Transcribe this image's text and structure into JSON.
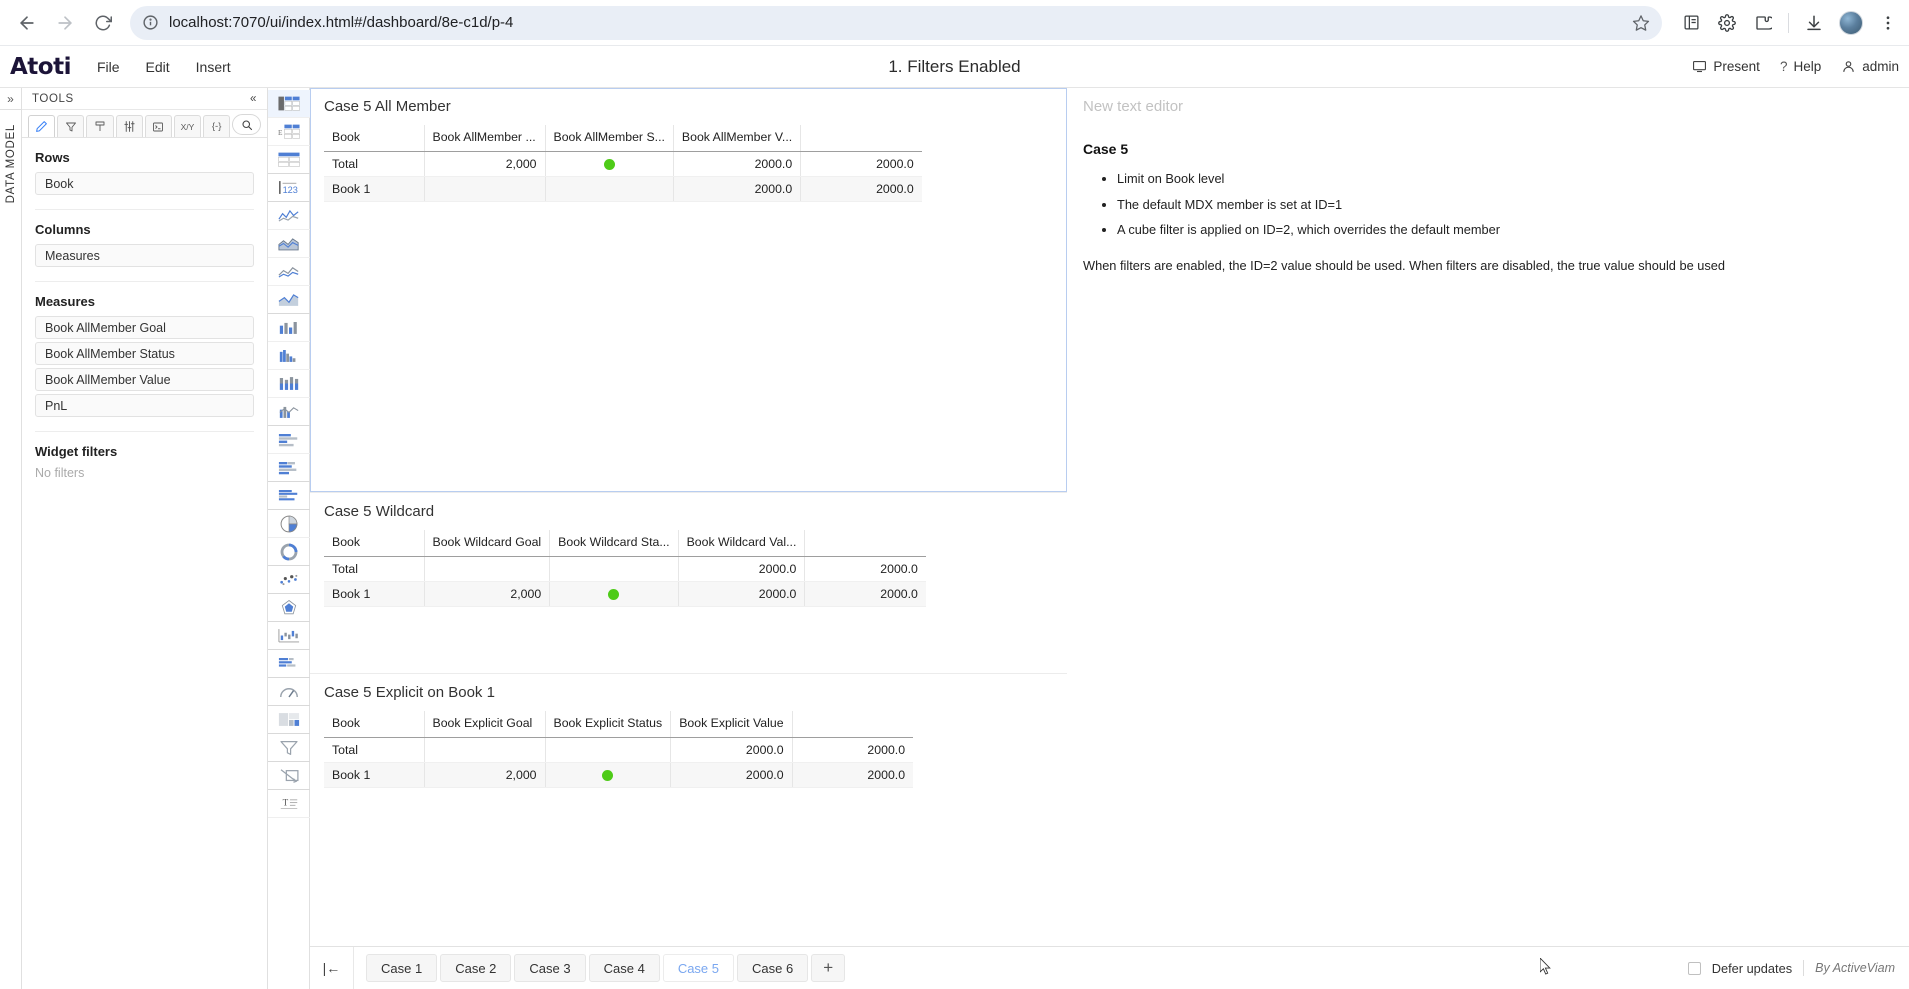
{
  "browser": {
    "url": "localhost:7070/ui/index.html#/dashboard/8e-c1d/p-4",
    "back_label": "←",
    "forward_label": "→",
    "reload_label": "⟳",
    "site_info_label": "ⓘ",
    "bookmark_label": "☆",
    "extension_labels": [
      "reading-list-icon",
      "gear-icon",
      "extensions-icon",
      "download-icon",
      "profile-avatar",
      "kebab-menu-icon"
    ]
  },
  "app": {
    "brand": "Atoti",
    "menu": [
      "File",
      "Edit",
      "Insert"
    ],
    "title": "1. Filters Enabled",
    "right": {
      "present": "Present",
      "help": "Help",
      "help_mark": "?",
      "user": "admin"
    }
  },
  "rail": {
    "expand": "»",
    "label": "DATA MODEL"
  },
  "tools": {
    "header": "TOOLS",
    "collapse": "«",
    "tabs": [
      {
        "name": "pencil-icon",
        "glyph": "✎",
        "active": true
      },
      {
        "name": "funnel-icon",
        "glyph": "∇",
        "active": false
      },
      {
        "name": "paintbrush-icon",
        "glyph": "✐",
        "active": false
      },
      {
        "name": "sliders-icon",
        "glyph": "⩝",
        "active": false
      },
      {
        "name": "console-icon",
        "glyph": "▣",
        "active": false
      },
      {
        "name": "xy-axis-icon",
        "glyph": "X/Y",
        "active": false
      },
      {
        "name": "expression-icon",
        "glyph": "{-}",
        "active": false
      }
    ],
    "search_icon": "search-icon",
    "sections": [
      {
        "title": "Rows",
        "items": [
          "Book"
        ]
      },
      {
        "title": "Columns",
        "items": [
          "Measures"
        ]
      },
      {
        "title": "Measures",
        "items": [
          "Book AllMember Goal",
          "Book AllMember Status",
          "Book AllMember Value",
          "PnL"
        ]
      }
    ],
    "widget_filters": {
      "title": "Widget filters",
      "empty": "No filters"
    }
  },
  "widget_palette": [
    {
      "name": "pivot-table-icon",
      "selected": true
    },
    {
      "name": "tree-table-icon",
      "selected": false
    },
    {
      "name": "table-icon",
      "selected": false
    },
    {
      "name": "kpi-number-icon",
      "selected": false,
      "group_end": true
    },
    {
      "name": "line-chart-icon",
      "selected": false
    },
    {
      "name": "area-chart-icon",
      "selected": false
    },
    {
      "name": "spline-chart-icon",
      "selected": false
    },
    {
      "name": "filled-area-chart-icon",
      "selected": false,
      "group_end": true
    },
    {
      "name": "column-chart-icon",
      "selected": false
    },
    {
      "name": "histogram-icon",
      "selected": false
    },
    {
      "name": "stacked-column-chart-icon",
      "selected": false
    },
    {
      "name": "combo-chart-icon",
      "selected": false,
      "group_end": true
    },
    {
      "name": "bar-chart-icon",
      "selected": false
    },
    {
      "name": "stacked-bar-chart-icon",
      "selected": false
    },
    {
      "name": "grouped-bar-chart-icon",
      "selected": false,
      "group_end": true
    },
    {
      "name": "pie-chart-icon",
      "selected": false
    },
    {
      "name": "donut-chart-icon",
      "selected": false,
      "group_end": true
    },
    {
      "name": "scatter-plot-icon",
      "selected": false,
      "group_end": true
    },
    {
      "name": "radar-chart-icon",
      "selected": false,
      "group_end": true
    },
    {
      "name": "waterfall-chart-icon",
      "selected": false,
      "group_end": true
    },
    {
      "name": "gantt-chart-icon",
      "selected": false,
      "group_end": true
    },
    {
      "name": "gauge-icon",
      "selected": false,
      "group_end": true
    },
    {
      "name": "layout-icon",
      "selected": false,
      "group_end": true
    },
    {
      "name": "filter-icon",
      "selected": false,
      "group_end": true
    },
    {
      "name": "drill-icon",
      "selected": false,
      "group_end": true
    },
    {
      "name": "text-editor-icon",
      "selected": false
    }
  ],
  "widgets": {
    "pivot1": {
      "title": "Case 5 All Member",
      "columns": [
        "Book",
        "Book AllMember ...",
        "Book AllMember S...",
        "Book AllMember V...",
        ""
      ],
      "rows": [
        {
          "cells": [
            "Total",
            "2,000",
            "status-green",
            "2000.0",
            "2000.0"
          ]
        },
        {
          "cells": [
            "Book 1",
            "",
            "",
            "2000.0",
            "2000.0"
          ]
        }
      ]
    },
    "pivot2": {
      "title": "Case 5 Wildcard",
      "columns": [
        "Book",
        "Book Wildcard Goal",
        "Book Wildcard Sta...",
        "Book Wildcard Val...",
        ""
      ],
      "rows": [
        {
          "cells": [
            "Total",
            "",
            "",
            "2000.0",
            "2000.0"
          ]
        },
        {
          "cells": [
            "Book 1",
            "2,000",
            "status-green",
            "2000.0",
            "2000.0"
          ]
        }
      ]
    },
    "pivot3": {
      "title": "Case 5 Explicit on Book 1",
      "columns": [
        "Book",
        "Book Explicit Goal",
        "Book Explicit Status",
        "Book Explicit Value",
        ""
      ],
      "rows": [
        {
          "cells": [
            "Total",
            "",
            "",
            "2000.0",
            "2000.0"
          ]
        },
        {
          "cells": [
            "Book 1",
            "2,000",
            "status-green",
            "2000.0",
            "2000.0"
          ]
        }
      ]
    },
    "text_editor": {
      "placeholder": "New text editor",
      "heading": "Case 5",
      "bullets": [
        "Limit on Book level",
        "The default MDX member is set at ID=1",
        "A cube filter is applied on ID=2, which overrides the default member"
      ],
      "paragraph": "When filters are enabled, the ID=2 value should be used. When filters are disabled, the true value should be used"
    }
  },
  "tabbar": {
    "collapse_glyph": "|←",
    "tabs": [
      {
        "label": "Case 1",
        "active": false
      },
      {
        "label": "Case 2",
        "active": false
      },
      {
        "label": "Case 3",
        "active": false
      },
      {
        "label": "Case 4",
        "active": false
      },
      {
        "label": "Case 5",
        "active": true
      },
      {
        "label": "Case 6",
        "active": false
      }
    ],
    "add_label": "+",
    "defer_updates": "Defer updates",
    "credit": "By ActiveViam"
  },
  "colors": {
    "status_green": "#4ecb18",
    "brand_dark": "#1c1438",
    "accent_blue": "#7aa7f0",
    "selection_border": "#b8cdf0"
  }
}
